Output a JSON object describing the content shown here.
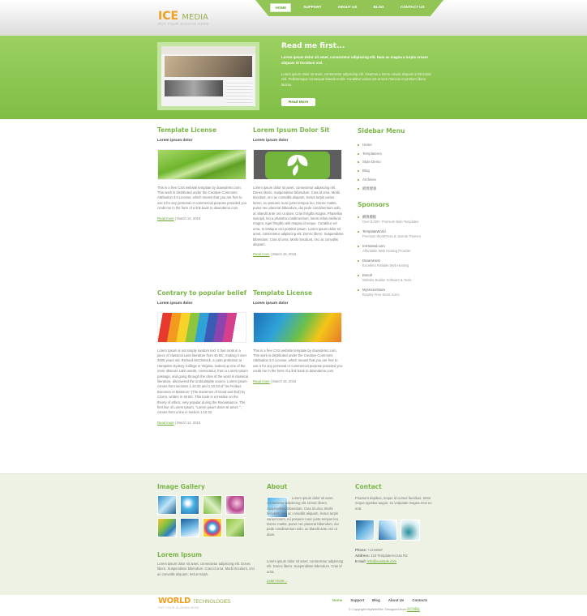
{
  "header": {
    "logo_main": "ICE",
    "logo_sub": "MEDIA",
    "slogan": "PUT YOUR SLOGAN HERE",
    "nav": [
      "HOME",
      "SUPPORT",
      "ABOUT US",
      "BLOG",
      "CONTACT US"
    ]
  },
  "banner": {
    "title": "Read me first...",
    "p1": "Lorem ipsum dolor sit amet, consectetur adipiscing elit. Nam ac magna a turpis ornare aliquam id tincidunt nisl.",
    "p2": "Lorem ipsum dolor sit amet, consectetur adipiscing elit. Vivamus a lorem ornare aliquam id tincidunt nisl. Pellentesque consequat blandit mollis. Curabitur varius est at sem rhoncus et pretium libero lacinia.",
    "button": "Read More"
  },
  "posts": [
    {
      "title": "Template License",
      "sub": "Lorem ipsum dolor",
      "text": "This is a free CSS website template by downdemo.com. This work is distributed under the Creative Commons Attribution 3.0 License, which means that you are free to use it for any personal or commercial purpose provided you credit me in the form of a link back to downdemo.com.",
      "readmore": "Read more",
      "date": " | March 14, 2015"
    },
    {
      "title": "Lorem Ipsum Dolor Sit",
      "sub": "Lorem ipsum dolor",
      "text": "Lorem ipsum dolor sit amet, consectetur adipiscing elit. Donec libero. Suspendisse bibendum. Cras id urna. Morbi tincidunt, orci ac convallis aliquam, lectus turpis varius lorem, eu posuere nunc justo tempus leo. Donec mattis, purus nec placerat bibendum, dui pede condimentum odio, ac blandit ante orci ut diam. Cras fringilla magna. Phasellus suscipit, leo a pharetra condimentum, lorem tellus eleifend magna, eget fringilla velit magna id neque. Curabitur vel urna. In tristique orci porttitor ipsum. Lorem ipsum dolor sit amet, consectetur adipiscing elit. Donec libero. Suspendisse bibendum. Cras id urna. Morbi tincidunt, orci ac convallis aliquam.",
      "readmore": "Read more",
      "date": " | March 15, 2015"
    },
    {
      "title": "Contrary to popular belief",
      "sub": "Lorem ipsum dolor",
      "text": "Lorem Ipsum is not simply random text. It has roots in a piece of classical Latin literature from 45 BC, making it over 2000 years old. Richard McClintock, a Latin professor at Hampden-Sydney College in Virginia, looked up one of the more obscure Latin words, consectetur, from a Lorem Ipsum passage, and going through the cites of the word in classical literature, discovered the undoubtable source. Lorem Ipsum comes from sections 1.10.32 and 1.10.33 of \"de Finibus Bonorum et Malorum\" (The Extremes of Good and Evil) by Cicero, written in 45 BC. This book is a treatise on the theory of ethics, very popular during the Renaissance. The first line of Lorem Ipsum, \"Lorem ipsum dolor sit amet..\", comes from a line in section 1.10.32.",
      "readmore": "Read more",
      "date": " | March 14, 2015"
    },
    {
      "title": "Template License",
      "sub": "Lorem ipsum dolor",
      "text": "This is a free CSS website template by downdemo.com. This work is distributed under the Creative Commons Attribution 3.0 License, which means that you are free to use it for any personal or commercial purpose provided you credit me in the form of a link back to downdemo.com.",
      "readmore": "Read more",
      "date": " | March 16, 2015"
    }
  ],
  "sidebar": {
    "title": "Sidebar Menu",
    "items": [
      "Home",
      "Templatemo",
      "Style Demo",
      "Blog",
      "Archives",
      "網頁模板"
    ],
    "sponsors_title": "Sponsors",
    "sponsors": [
      {
        "t": "網頁模板",
        "d": "Over 8,000+ Premium Web Templates"
      },
      {
        "t": "TemplateWorld",
        "d": "Premium WordPress & Joomla Themes"
      },
      {
        "t": "ImHosted.com",
        "d": "Affordable Web Hosting Provider"
      },
      {
        "t": "DreamHost",
        "d": "Excellent Reliable Web Hosting"
      },
      {
        "t": "Evnoll",
        "d": "Website Builder Software & Tools"
      },
      {
        "t": "MyVectorStore",
        "d": "Royalty Free Stock Icons"
      }
    ]
  },
  "bottom": {
    "gallery_title": "Image Gallery",
    "lorem_title": "Lorem Ipsum",
    "lorem_text": "Lorem ipsum dolor sit amet, consectetur adipiscing elit. Donec libero. Suspendisse bibendum. Cras id urna. Morbi tincidunt, orci ac convallis aliquam, lectus turpis.",
    "about_title": "About",
    "about_text1": "Lorem ipsum dolor sit amet, consectetur adipiscing elit. Donec libero. Suspendisse bibendum. Cras id urna. Morbi tincidunt, orci ac convallis aliquam, lectus turpis varius lorem, eu posuere nunc justo tempus leo. Donec mattis, purus nec placerat bibendum, dui pede condimentum odio, ac blandit ante orci ut diam.",
    "about_text2": "Lorem ipsum dolor sit amet, consectetur adipiscing elit. Donec libero. Suspendisse bibendum. Cras id urna.",
    "learn_more": "Learn more...",
    "contact_title": "Contact",
    "contact_text": "Praesent dapibus, neque id cursus faucibus, tortor neque egestas augue, eu vulputate magna eros eu erat.",
    "phone_label": "Phone:",
    "phone": " +1234567",
    "address_label": "Address:",
    "address": " 123 TemplateAccess Rd",
    "email_label": "E-mail:",
    "email": " info@example.com"
  },
  "footer": {
    "logo_main": "WORLD",
    "logo_sub": "TECHNOLOGIES",
    "slogan": "PUT YOUR SLOGAN HERE",
    "nav": [
      "Home",
      "Support",
      "Blog",
      "About Us",
      "Contacts"
    ],
    "copyright": "© Copyright MyWebSite. Designed from ",
    "credit": "网页模板"
  }
}
